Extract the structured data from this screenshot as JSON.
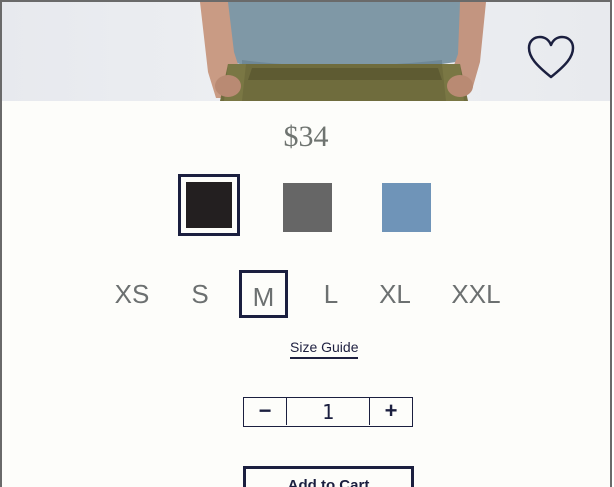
{
  "product": {
    "price": "$34",
    "favorite_icon": "heart-outline-icon"
  },
  "colors": {
    "swatches": [
      {
        "name": "black",
        "hex": "#231f20",
        "selected": true
      },
      {
        "name": "gray",
        "hex": "#666666",
        "selected": false
      },
      {
        "name": "blue",
        "hex": "#6f94b8",
        "selected": false
      }
    ],
    "selected_border": "#1b1f3f"
  },
  "sizes": {
    "options": [
      "XS",
      "S",
      "M",
      "L",
      "XL",
      "XXL"
    ],
    "selected": "M",
    "guide_label": "Size Guide"
  },
  "quantity": {
    "minus": "−",
    "value": "1",
    "plus": "+"
  },
  "cart": {
    "add_label": "Add to Cart"
  }
}
